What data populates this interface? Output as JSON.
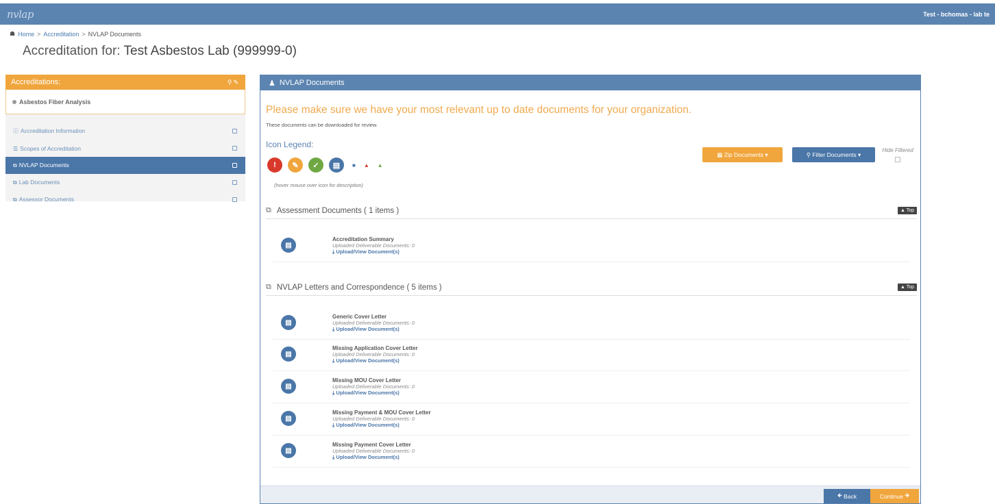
{
  "topbar": {
    "logo": "nvlap",
    "user": "Test - bchomas - lab te"
  },
  "breadcrumb": {
    "home": "Home",
    "sep1": ">",
    "accreditation": "Accreditation",
    "sep2": ">",
    "current": "NVLAP Documents"
  },
  "page": {
    "title_prefix": "Accreditation for:",
    "title_lab": "Test Asbestos Lab (999999-0)"
  },
  "sidebar": {
    "header": "Accreditations:",
    "program": "Asbestos Fiber Analysis",
    "items": [
      {
        "label": "Accreditation Information",
        "icon": "info-icon"
      },
      {
        "label": "Scopes of Accreditation",
        "icon": "list-icon"
      },
      {
        "label": "NVLAP Documents",
        "icon": "copy-icon"
      },
      {
        "label": "Lab Documents",
        "icon": "copy-icon"
      },
      {
        "label": "Assessor Documents",
        "icon": "copy-icon"
      }
    ]
  },
  "panel": {
    "header": "NVLAP Documents",
    "notice": "Please make sure we have your most relevant up to date documents for your organization.",
    "notice_sub": "These documents can be downloaded for review.",
    "legend_title": "Icon Legend:",
    "legend_hint": "(hover mouse over icon for description)",
    "zip_label": "Zip Documents",
    "filter_label": "Filter Documents",
    "hide_filtered": "Hide Filtered",
    "top_label": "Top",
    "sections": [
      {
        "title": "Assessment Documents ( 1 items )",
        "docs": [
          {
            "title": "Accreditation Summary",
            "sub": "Uploaded Deliverable Documents: 0",
            "link": "Upload/View Document(s)"
          }
        ]
      },
      {
        "title": "NVLAP Letters and Correspondence ( 5 items )",
        "docs": [
          {
            "title": "Generic Cover Letter",
            "sub": "Uploaded Deliverable Documents: 0",
            "link": "Upload/View Document(s)"
          },
          {
            "title": "Missing Application Cover Letter",
            "sub": "Uploaded Deliverable Documents: 0",
            "link": "Upload/View Document(s)"
          },
          {
            "title": "Missing MOU Cover Letter",
            "sub": "Uploaded Deliverable Documents: 0",
            "link": "Upload/View Document(s)"
          },
          {
            "title": "Missing Payment & MOU Cover Letter",
            "sub": "Uploaded Deliverable Documents: 0",
            "link": "Upload/View Document(s)"
          },
          {
            "title": "Missing Payment Cover Letter",
            "sub": "Uploaded Deliverable Documents: 0",
            "link": "Upload/View Document(s)"
          }
        ]
      }
    ],
    "back_label": "Back",
    "continue_label": "Continue"
  },
  "colors": {
    "primary": "#5b84b1",
    "accent": "#f0a63d",
    "danger": "#d9392b",
    "success": "#6fa843"
  }
}
